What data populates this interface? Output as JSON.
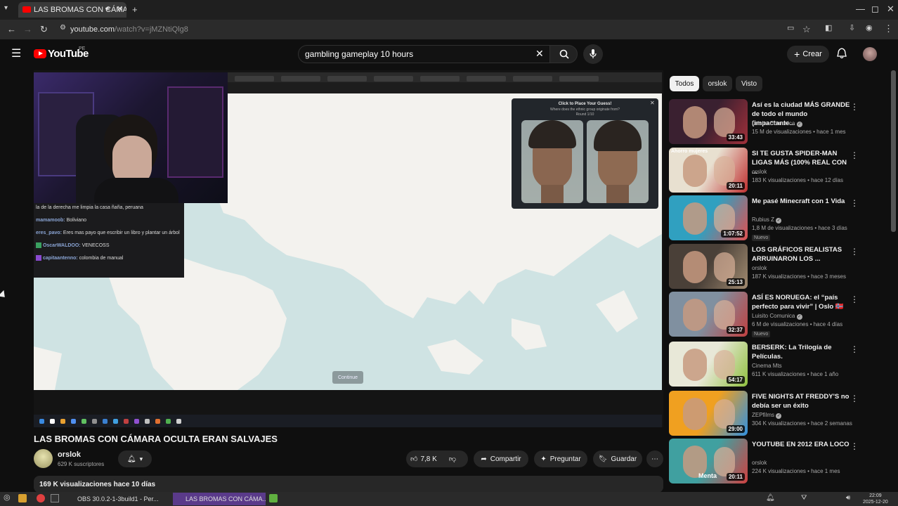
{
  "browser": {
    "tab_title": "LAS BROMAS CON CÁMA",
    "url_host": "youtube.com",
    "url_path": "/watch?v=jMZNtiQlg8"
  },
  "header": {
    "logo": "YouTube",
    "region": "PE",
    "search_value": "gambling gameplay 10 hours",
    "create_label": "Crear"
  },
  "player": {
    "guess_title": "Click to Place Your Guess!",
    "guess_subtitle": "Where does the ethnic group originate from?",
    "guess_round": "Round 1/10",
    "continue_label": "Continue",
    "chat": [
      {
        "nick": "",
        "text": "la de la derecha me limpia la casa ñaña, peruana"
      },
      {
        "nick": "mamamoob:",
        "text": "Boliviano"
      },
      {
        "nick": "eres_pavo:",
        "text": "Eres mas payo que escribir un libro y plantar un árbol"
      },
      {
        "nick": "OscarWALDOO:",
        "text": "VENECOSS"
      },
      {
        "nick": "capitaantenno:",
        "text": "colombia de manual"
      }
    ]
  },
  "video": {
    "title": "LAS BROMAS CON CÁMARA OCULTA ERAN SALVAJES",
    "channel": "orslok",
    "subscribers": "629 K suscriptores",
    "likes": "7,8 K",
    "share_label": "Compartir",
    "ask_label": "Preguntar",
    "save_label": "Guardar",
    "views_line": "169 K visualizaciones  hace 10 días"
  },
  "chips": [
    "Todos",
    "orslok",
    "Visto"
  ],
  "recommendations": [
    {
      "title": "Así es la ciudad MÁS GRANDE de todo el mundo (impactante...",
      "channel": "Luisito Comunica",
      "verified": true,
      "meta": "15 M de visualizaciones • hace 1 mes",
      "duration": "33:43",
      "badge": "",
      "colors": [
        "#3a2030",
        "#a0303a"
      ]
    },
    {
      "title": "SI TE GUSTA SPIDER-MAN LIGAS MÁS (100% REAL CON ...",
      "channel": "orslok",
      "verified": false,
      "meta": "183 K visualizaciones • hace 12 días",
      "duration": "20:11",
      "badge": "",
      "colors": [
        "#e8e0d0",
        "#c03030"
      ]
    },
    {
      "title": "Me pasé Minecraft con 1 Vida",
      "channel": "Rubius Z",
      "verified": true,
      "meta": "1,8 M de visualizaciones • hace 3 días",
      "duration": "1:07:52",
      "badge": "Nuevo",
      "colors": [
        "#30a0c0",
        "#e05050"
      ]
    },
    {
      "title": "LOS GRÁFICOS REALISTAS ARRUINARON LOS ...",
      "channel": "orslok",
      "verified": false,
      "meta": "187 K visualizaciones • hace 3 meses",
      "duration": "25:13",
      "badge": "",
      "colors": [
        "#4a4038",
        "#a08a70"
      ]
    },
    {
      "title": "ASÍ ES NORUEGA: el “país perfecto para vivir” | Oslo 🇳🇴",
      "channel": "Luisito Comunica",
      "verified": true,
      "meta": "6 M de visualizaciones • hace 4 días",
      "duration": "32:37",
      "badge": "Nuevo",
      "colors": [
        "#8090a0",
        "#c04040"
      ]
    },
    {
      "title": "BERSERK: La Trilogía de Películas.",
      "channel": "Cinema Mts",
      "verified": false,
      "meta": "611 K visualizaciones • hace 1 año",
      "duration": "54:17",
      "badge": "",
      "colors": [
        "#e8e8d8",
        "#90c040"
      ]
    },
    {
      "title": "FIVE NIGHTS AT FREDDY'S no debía ser un éxito",
      "channel": "ZEPfilms",
      "verified": true,
      "meta": "304 K visualizaciones • hace 2 semanas",
      "duration": "29:00",
      "badge": "",
      "colors": [
        "#f0a020",
        "#3090e0"
      ]
    },
    {
      "title": "YOUTUBE EN 2012 ERA LOCO",
      "channel": "orslok",
      "verified": false,
      "meta": "224 K visualizaciones • hace 1 mes",
      "duration": "20:11",
      "badge": "",
      "colors": [
        "#40a0a0",
        "#d04040"
      ]
    }
  ],
  "thumb_texts": [
    "Menta",
    "Ahorro mujeres"
  ],
  "os_taskbar": {
    "items": [
      "OBS 30.0.2-1-3build1 - Per...",
      "LAS BROMAS CON CÁMA..."
    ],
    "time": "22:09",
    "date": "2025-12-20"
  }
}
